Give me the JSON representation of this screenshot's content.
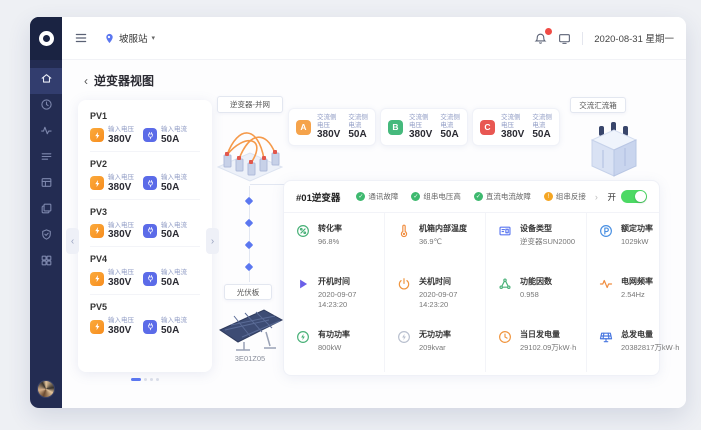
{
  "topbar": {
    "station": "坡服站",
    "caret": "▾",
    "date": "2020-08-31 星期一"
  },
  "sidebar": {
    "icons": [
      {
        "name": "home",
        "active": true
      },
      {
        "name": "clock",
        "active": false
      },
      {
        "name": "activity",
        "active": false
      },
      {
        "name": "list",
        "active": false
      },
      {
        "name": "storage",
        "active": false
      },
      {
        "name": "layers",
        "active": false
      },
      {
        "name": "shield",
        "active": false
      },
      {
        "name": "apps",
        "active": false
      }
    ]
  },
  "page": {
    "back": "‹",
    "title": "逆变器视图"
  },
  "pv": {
    "labels": {
      "voltage": "输入电压",
      "current": "输入电流"
    },
    "items": [
      {
        "name": "PV1",
        "voltage": "380V",
        "current": "50A"
      },
      {
        "name": "PV2",
        "voltage": "380V",
        "current": "50A"
      },
      {
        "name": "PV3",
        "voltage": "380V",
        "current": "50A"
      },
      {
        "name": "PV4",
        "voltage": "380V",
        "current": "50A"
      },
      {
        "name": "PV5",
        "voltage": "380V",
        "current": "50A"
      }
    ],
    "prev": "‹",
    "next": "›"
  },
  "diagram": {
    "inverter_label": "逆变器-并网",
    "combiner_label": "交流汇流箱",
    "panel_label": "光伏板",
    "panel_code": "3E01Z05",
    "phase_labels": {
      "voltage": "交流侧电压",
      "current": "交流侧电流"
    },
    "phases": [
      {
        "id": "A",
        "color": "#F5A34B",
        "voltage": "380V",
        "current": "50A"
      },
      {
        "id": "B",
        "color": "#45B97C",
        "voltage": "380V",
        "current": "50A"
      },
      {
        "id": "C",
        "color": "#E85752",
        "voltage": "380V",
        "current": "50A"
      }
    ]
  },
  "detail": {
    "title": "#01逆变器",
    "statuses": [
      {
        "label": "通讯故障",
        "state": "ok",
        "mark": "✓"
      },
      {
        "label": "组串电压高",
        "state": "ok",
        "mark": "✓"
      },
      {
        "label": "直流电流故障",
        "state": "ok",
        "mark": "✓"
      },
      {
        "label": "组串反接",
        "state": "warn",
        "mark": "!"
      }
    ],
    "more": "›",
    "switch_label": "开",
    "switch_on": true,
    "stats": [
      {
        "title": "转化率",
        "value": "96.8%",
        "icon": "percent",
        "color": "#49B178"
      },
      {
        "title": "机箱内部温度",
        "value": "36.9℃",
        "icon": "thermo",
        "color": "#F08C3E"
      },
      {
        "title": "设备类型",
        "value": "逆变器SUN2000",
        "icon": "device",
        "color": "#5B77F0"
      },
      {
        "title": "额定功率",
        "value": "1029kW",
        "icon": "powerp",
        "color": "#4A90E2"
      },
      {
        "title": "开机时间",
        "value": "2020-09-07 14:23:20",
        "icon": "play",
        "color": "#6A5FE8"
      },
      {
        "title": "关机时间",
        "value": "2020-09-07 14:23:20",
        "icon": "poweroff",
        "color": "#F0953E"
      },
      {
        "title": "功能因数",
        "value": "0.958",
        "icon": "net",
        "color": "#49B178"
      },
      {
        "title": "电网频率",
        "value": "2.54Hz",
        "icon": "wave",
        "color": "#F08C3E"
      },
      {
        "title": "有功功率",
        "value": "800kW",
        "icon": "boltc",
        "color": "#49B178"
      },
      {
        "title": "无功功率",
        "value": "209kvar",
        "icon": "boltc",
        "color": "#B9C0CF"
      },
      {
        "title": "当日发电量",
        "value": "29102.09万kW·h",
        "icon": "clock",
        "color": "#F0953E"
      },
      {
        "title": "总发电量",
        "value": "20382817万kW·h",
        "icon": "panel",
        "color": "#4A78E0"
      }
    ]
  }
}
